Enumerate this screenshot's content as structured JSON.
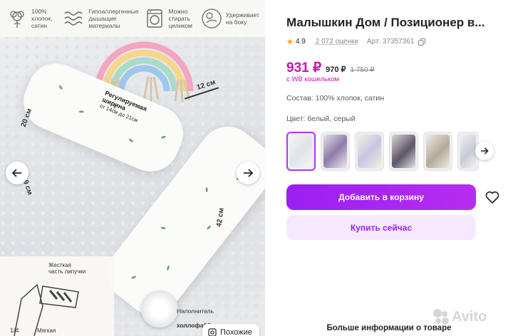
{
  "gallery": {
    "features": [
      {
        "icon": "cotton-icon",
        "text": "100%\nхлопок,\nсатин"
      },
      {
        "icon": "waves-icon",
        "text": "Гипоаллергенные\nдышащие\nматериалы"
      },
      {
        "icon": "washing-machine-icon",
        "text": "Можно\nстирать\nцеликом"
      },
      {
        "icon": "baby-sleep-icon",
        "text": "Удерживает\nна боку"
      }
    ],
    "dim_12": "12 см",
    "dim_20": "20 см",
    "dim_9": "9 см",
    "dim_42": "42 см",
    "adjustable_label": "Регулируемая\nширина",
    "adjustable_range": "от 14см до 21см",
    "velcro_label": "Жесткая\nчасть липучки",
    "soft_label": "Мягкая",
    "filler_label": "Наполнитель",
    "filler_material": "холлофайбер",
    "counter": "1/4",
    "similar_button": "Похожие"
  },
  "product": {
    "title": "Малышкин Дом / Позиционер в...",
    "rating": "4.9",
    "reviews": "2 072 оценки",
    "article_label": "Арт: 37357361",
    "price_main": "931 ₽",
    "price_sub": "970 ₽",
    "price_old": "1 750 ₽",
    "wallet_note": "с WB кошельком",
    "composition": "Состав: 100% хлопок, сатин",
    "color": "Цвет: белый, серый",
    "add_to_cart": "Добавить в корзину",
    "buy_now": "Купить сейчас",
    "more_info": "Больше информации о товаре"
  },
  "watermark": "Avito",
  "colors": {
    "accent": "#9b1ff3",
    "price": "#cb11ab",
    "star": "#ff9f00"
  }
}
